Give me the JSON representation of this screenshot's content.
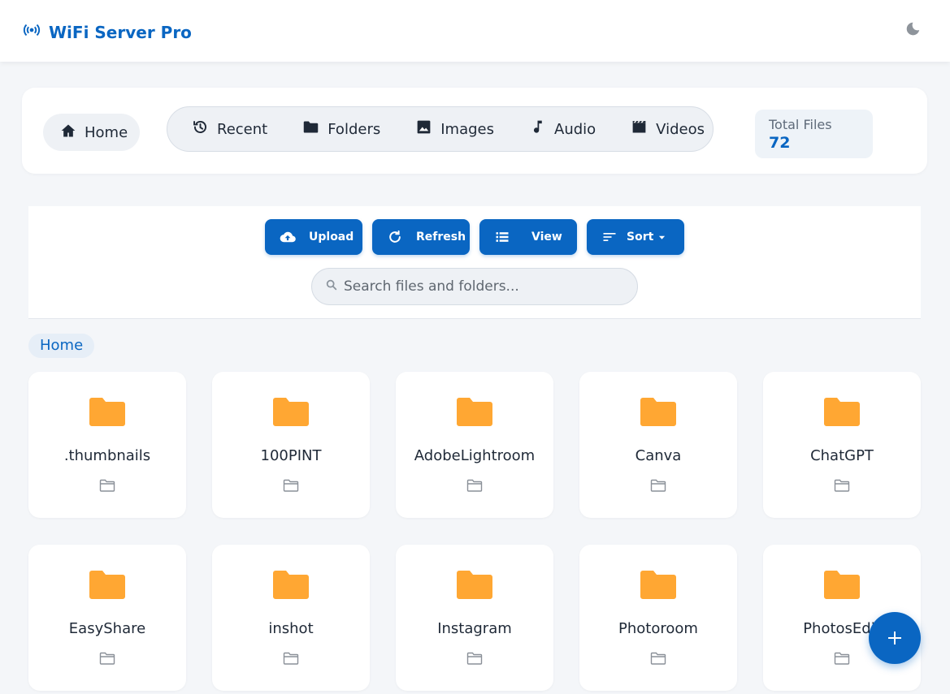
{
  "header": {
    "title": "WiFi Server Pro",
    "logo_icon": "wifi-broadcast-icon",
    "theme_icon": "moon-icon",
    "accent_color": "#0a66c2"
  },
  "nav": {
    "home_label": "Home",
    "categories": [
      {
        "label": "Recent",
        "icon": "history-icon"
      },
      {
        "label": "Folders",
        "icon": "folder-icon"
      },
      {
        "label": "Images",
        "icon": "image-icon"
      },
      {
        "label": "Audio",
        "icon": "music-note-icon"
      },
      {
        "label": "Videos",
        "icon": "film-icon"
      }
    ],
    "total_files_label": "Total Files",
    "total_files_value": "72"
  },
  "toolbar": {
    "upload_label": "Upload",
    "refresh_label": "Refresh",
    "view_label": "View",
    "sort_label": "Sort",
    "search_placeholder": "Search files and folders..."
  },
  "breadcrumb": {
    "current": "Home"
  },
  "folders": [
    {
      "name": ".thumbnails"
    },
    {
      "name": "100PINT"
    },
    {
      "name": "AdobeLightroom"
    },
    {
      "name": "Canva"
    },
    {
      "name": "ChatGPT"
    },
    {
      "name": "EasyShare"
    },
    {
      "name": "inshot"
    },
    {
      "name": "Instagram"
    },
    {
      "name": "Photoroom"
    },
    {
      "name": "PhotosEdit"
    }
  ],
  "folder_color": "#ffa733",
  "fab_icon": "plus-icon"
}
